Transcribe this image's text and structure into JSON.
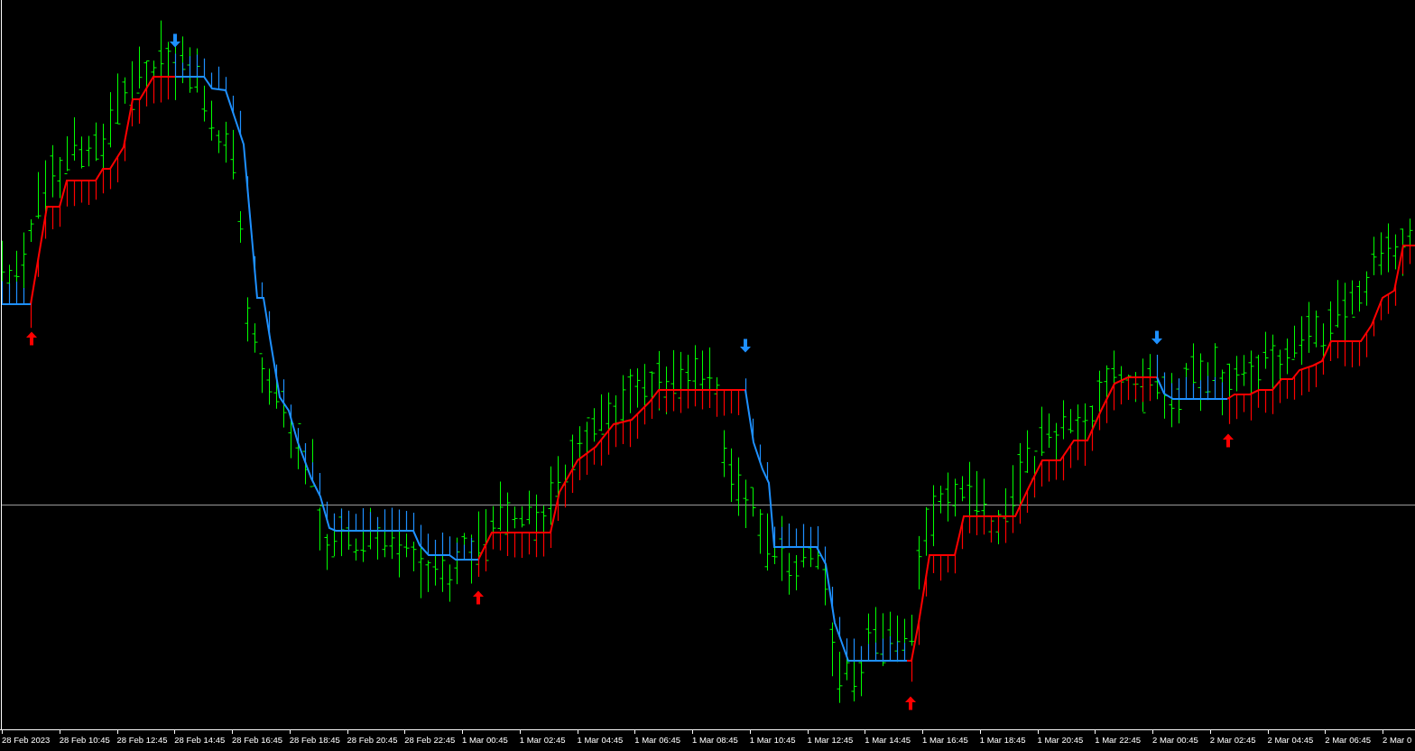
{
  "time_axis": {
    "labels": [
      "28 Feb 2023",
      "28 Feb 10:45",
      "28 Feb 12:45",
      "28 Feb 14:45",
      "28 Feb 16:45",
      "28 Feb 18:45",
      "28 Feb 20:45",
      "28 Feb 22:45",
      "1 Mar 00:45",
      "1 Mar 02:45",
      "1 Mar 04:45",
      "1 Mar 06:45",
      "1 Mar 08:45",
      "1 Mar 10:45",
      "1 Mar 12:45",
      "1 Mar 14:45",
      "1 Mar 16:45",
      "1 Mar 18:45",
      "1 Mar 20:45",
      "1 Mar 22:45",
      "2 Mar 00:45",
      "2 Mar 02:45",
      "2 Mar 04:45",
      "2 Mar 06:45",
      "2 Mar 0"
    ]
  }
}
